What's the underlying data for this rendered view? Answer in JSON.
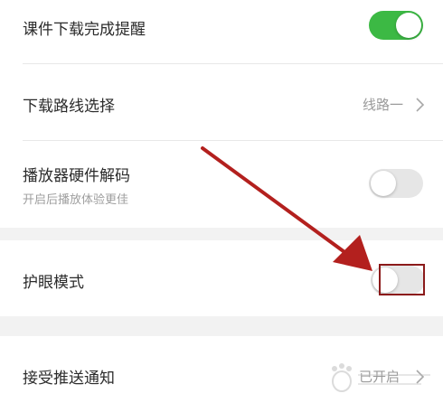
{
  "settings": {
    "download_reminder": {
      "label": "课件下载完成提醒",
      "enabled": true
    },
    "download_route": {
      "label": "下载路线选择",
      "value": "线路一"
    },
    "hardware_decode": {
      "label": "播放器硬件解码",
      "sublabel": "开启后播放体验更佳",
      "enabled": false
    },
    "eye_protection": {
      "label": "护眼模式",
      "enabled": false
    },
    "push_notifications": {
      "label": "接受推送通知",
      "value": "已开启"
    }
  },
  "colors": {
    "toggle_on": "#3cb944",
    "toggle_off": "#e6e6e6",
    "annotation_arrow": "#b3201e",
    "annotation_box": "#8b1a1a",
    "section_gap": "#f2f2f2"
  },
  "icons": {
    "chevron": "chevron-right-icon",
    "annotation": "arrow-annotation",
    "watermark": "baidu-paw-watermark"
  }
}
